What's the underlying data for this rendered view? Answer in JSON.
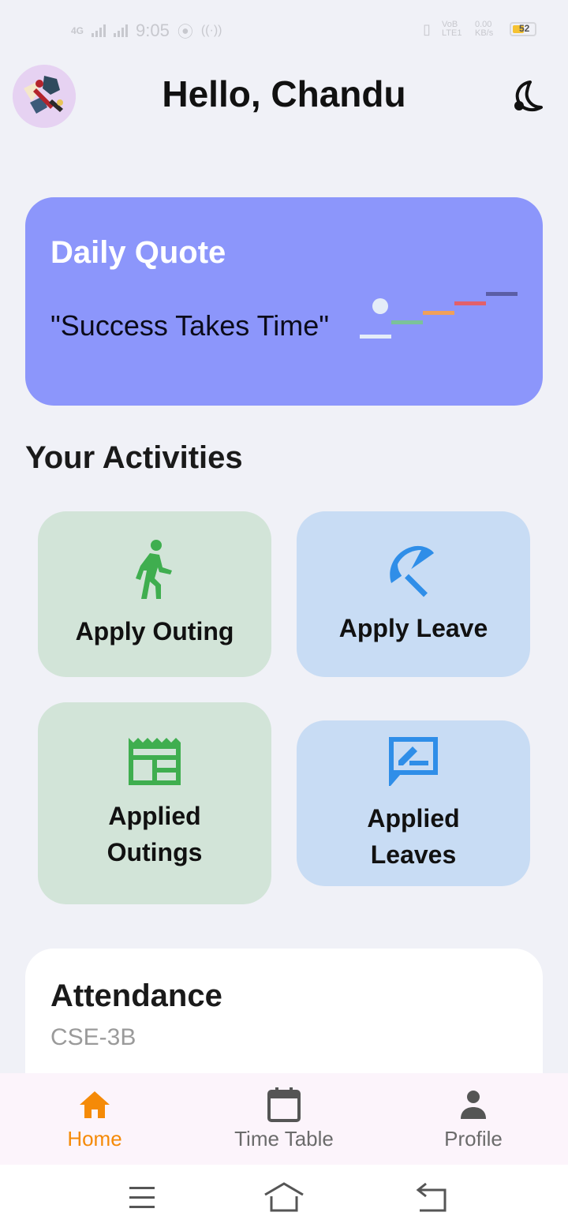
{
  "status_bar": {
    "network": "4G",
    "time": "9:05",
    "volte": "VoB LTE1",
    "speed": "0.00 KB/s",
    "battery": "52"
  },
  "header": {
    "greeting": "Hello, Chandu",
    "avatar_icon": "avatar-icon",
    "theme_icon": "moon-icon"
  },
  "quote_card": {
    "title": "Daily Quote",
    "text": "\"Success Takes Time\"",
    "background": "#8c96fb"
  },
  "activities": {
    "title": "Your Activities",
    "tiles": [
      {
        "label": "Apply Outing",
        "icon": "walking-person-icon",
        "color": "#3fae4f"
      },
      {
        "label": "Apply Leave",
        "icon": "beach-umbrella-icon",
        "color": "#2f8ee8"
      },
      {
        "label": "Applied Outings",
        "icon": "receipt-list-icon",
        "color": "#3fae4f"
      },
      {
        "label": "Applied Leaves",
        "icon": "rate-review-icon",
        "color": "#2f8ee8"
      }
    ]
  },
  "attendance": {
    "title": "Attendance",
    "class": "CSE-3B"
  },
  "bottom_nav": {
    "items": [
      {
        "label": "Home",
        "icon": "home-icon",
        "active": true
      },
      {
        "label": "Time Table",
        "icon": "calendar-icon",
        "active": false
      },
      {
        "label": "Profile",
        "icon": "person-icon",
        "active": false
      }
    ],
    "active_color": "#f58a07"
  },
  "system_nav": {
    "menu_icon": "menu-icon",
    "home_icon": "system-home-icon",
    "back_icon": "back-icon"
  }
}
